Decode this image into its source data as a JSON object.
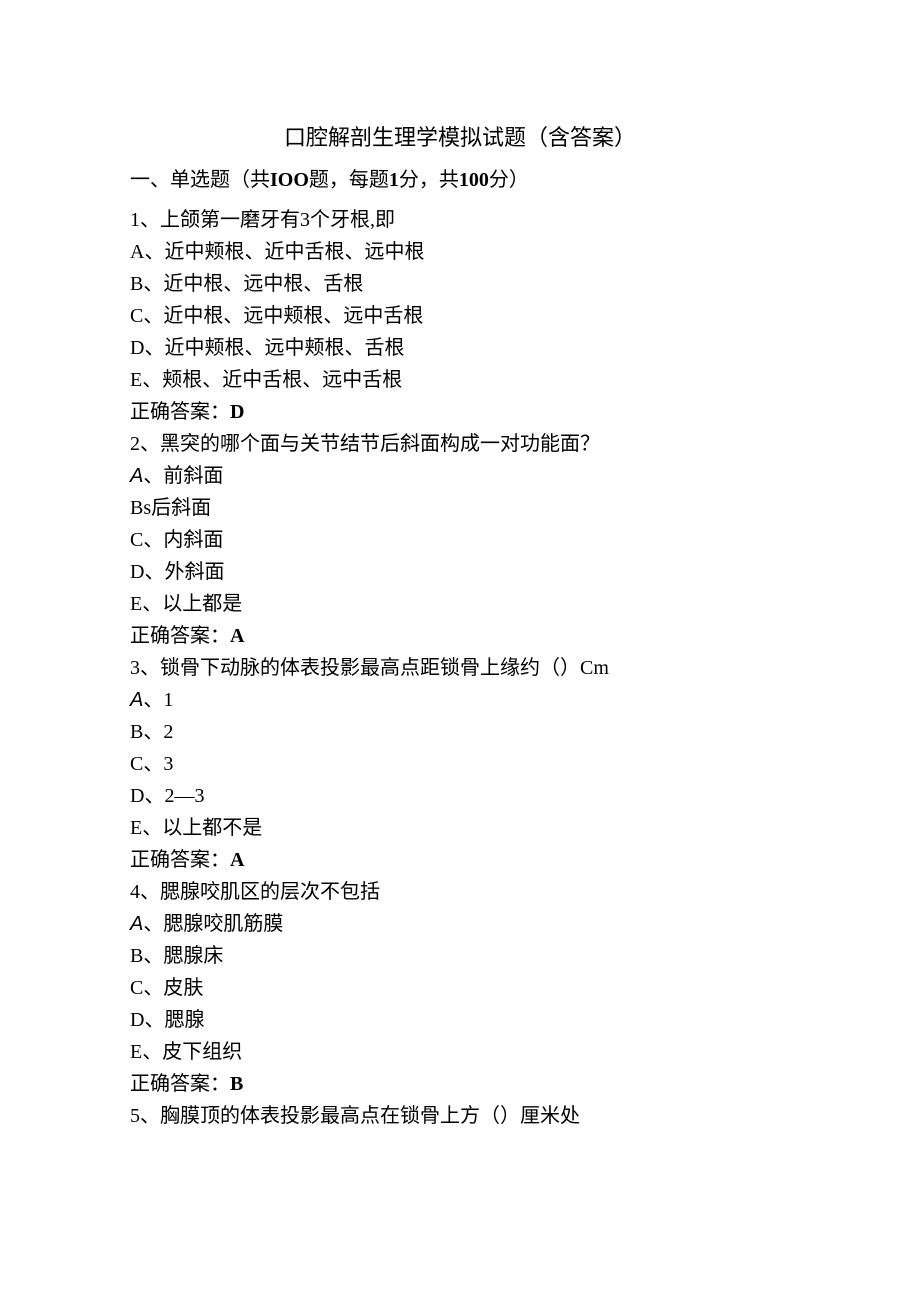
{
  "title": "口腔解剖生理学模拟试题（含答案）",
  "section_header": {
    "prefix": "一、单选题（共",
    "count1": "IOO",
    "mid1": "题，每题",
    "score_each": "1",
    "mid2": "分，共",
    "count2": "100",
    "suffix": "分）"
  },
  "questions": [
    {
      "num": "1",
      "stem": "、上颌第一磨牙有3个牙根,即",
      "options": [
        {
          "label": "A",
          "sep": "、",
          "text": "近中颊根、近中舌根、远中根"
        },
        {
          "label": "B",
          "sep": "、",
          "text": "近中根、远中根、舌根"
        },
        {
          "label": "C",
          "sep": "、",
          "text": "近中根、远中颊根、远中舌根"
        },
        {
          "label": "D",
          "sep": "、",
          "text": "近中颊根、远中颊根、舌根"
        },
        {
          "label": "E",
          "sep": "、",
          "text": "颊根、近中舌根、远中舌根"
        }
      ],
      "answer_label": "正确答案：",
      "answer": "D"
    },
    {
      "num": "2",
      "stem": "、黑突的哪个面与关节结节后斜面构成一对功能面？",
      "options": [
        {
          "label": "A",
          "sep": "、",
          "text": "前斜面",
          "arial": true
        },
        {
          "label": "Bs",
          "sep": "",
          "text": "后斜面"
        },
        {
          "label": "C",
          "sep": "、",
          "text": "内斜面"
        },
        {
          "label": "D",
          "sep": "、",
          "text": "外斜面"
        },
        {
          "label": "E",
          "sep": "、",
          "text": "以上都是"
        }
      ],
      "answer_label": "正确答案：",
      "answer": "A"
    },
    {
      "num": "3",
      "stem": "、锁骨下动脉的体表投影最高点距锁骨上缘约（）Cm",
      "options": [
        {
          "label": "A",
          "sep": "、",
          "text": "1",
          "arial": true
        },
        {
          "label": "B",
          "sep": "、",
          "text": "2"
        },
        {
          "label": "C",
          "sep": "、",
          "text": "3"
        },
        {
          "label": "D",
          "sep": "、",
          "text": "2—3"
        },
        {
          "label": "E",
          "sep": "、",
          "text": "以上都不是"
        }
      ],
      "answer_label": "正确答案：",
      "answer": "A"
    },
    {
      "num": "4",
      "stem": "、腮腺咬肌区的层次不包括",
      "options": [
        {
          "label": "A",
          "sep": "、",
          "text": "腮腺咬肌筋膜",
          "arial": true
        },
        {
          "label": "B",
          "sep": "、",
          "text": "腮腺床"
        },
        {
          "label": "C",
          "sep": "、",
          "text": "皮肤"
        },
        {
          "label": "D",
          "sep": "、",
          "text": "腮腺"
        },
        {
          "label": "E",
          "sep": "、",
          "text": "皮下组织"
        }
      ],
      "answer_label": "正确答案：",
      "answer": "B"
    },
    {
      "num": "5",
      "stem": "、胸膜顶的体表投影最高点在锁骨上方（）厘米处",
      "options": [],
      "answer_label": "",
      "answer": ""
    }
  ]
}
